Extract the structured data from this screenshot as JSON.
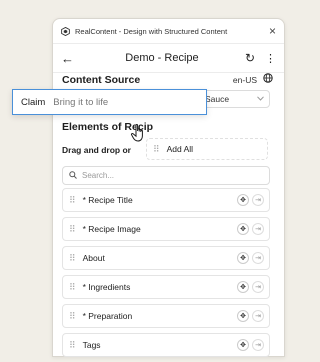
{
  "window": {
    "title": "RealContent - Design with Structured Content",
    "close_icon": "×"
  },
  "header": {
    "back_icon": "←",
    "title": "Demo - Recipe",
    "refresh_icon": "↻",
    "more_icon": "⋮"
  },
  "content_source": {
    "label": "Content Source",
    "lang": "en-US",
    "globe_icon": "⊕",
    "selected": "Sauce"
  },
  "overlay": {
    "label": "Claim",
    "placeholder": "Bring it to life"
  },
  "elements": {
    "title": "Elements of Recip",
    "drag_text": "Drag and drop or",
    "add_all": "Add All",
    "search_placeholder": "Search...",
    "items": [
      {
        "label": "* Recipe Title"
      },
      {
        "label": "* Recipe Image"
      },
      {
        "label": "About"
      },
      {
        "label": "* Ingredients"
      },
      {
        "label": "* Preparation"
      },
      {
        "label": "Tags"
      }
    ]
  },
  "colors": {
    "background": "#f1eee7",
    "accent": "#4a90d9"
  }
}
